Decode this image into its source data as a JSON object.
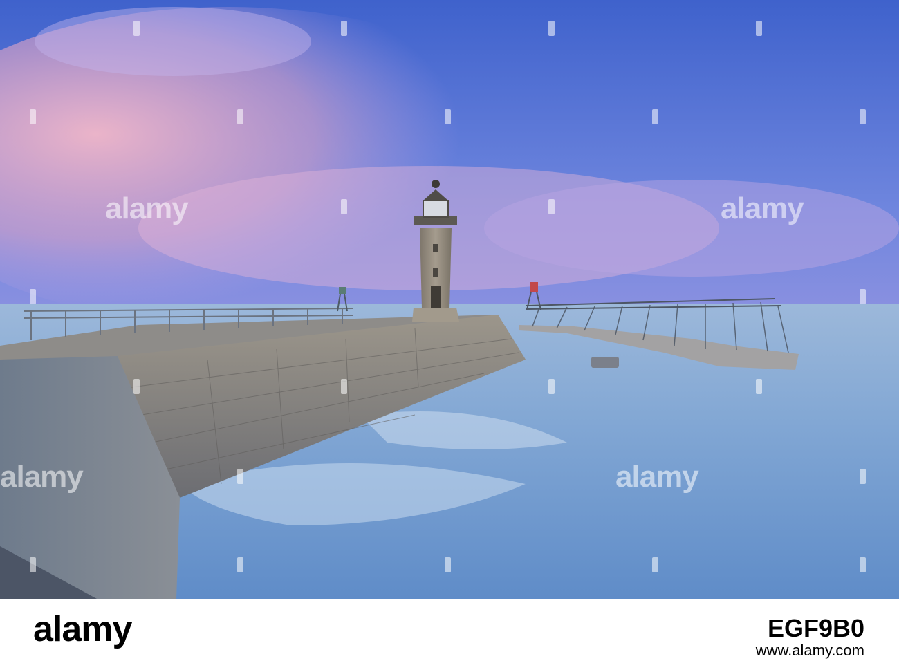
{
  "watermark": {
    "text": "alamy"
  },
  "footer": {
    "logo": "alamy",
    "image_id": "EGF9B0",
    "url": "www.alamy.com"
  },
  "colors": {
    "sky_top": "#4a6ad0",
    "sky_mid": "#8b8fe0",
    "pink_cloud": "#e9a7c0",
    "sea": "#7fa6d2",
    "stone": "#8c8a86",
    "brand_black": "#000000"
  }
}
